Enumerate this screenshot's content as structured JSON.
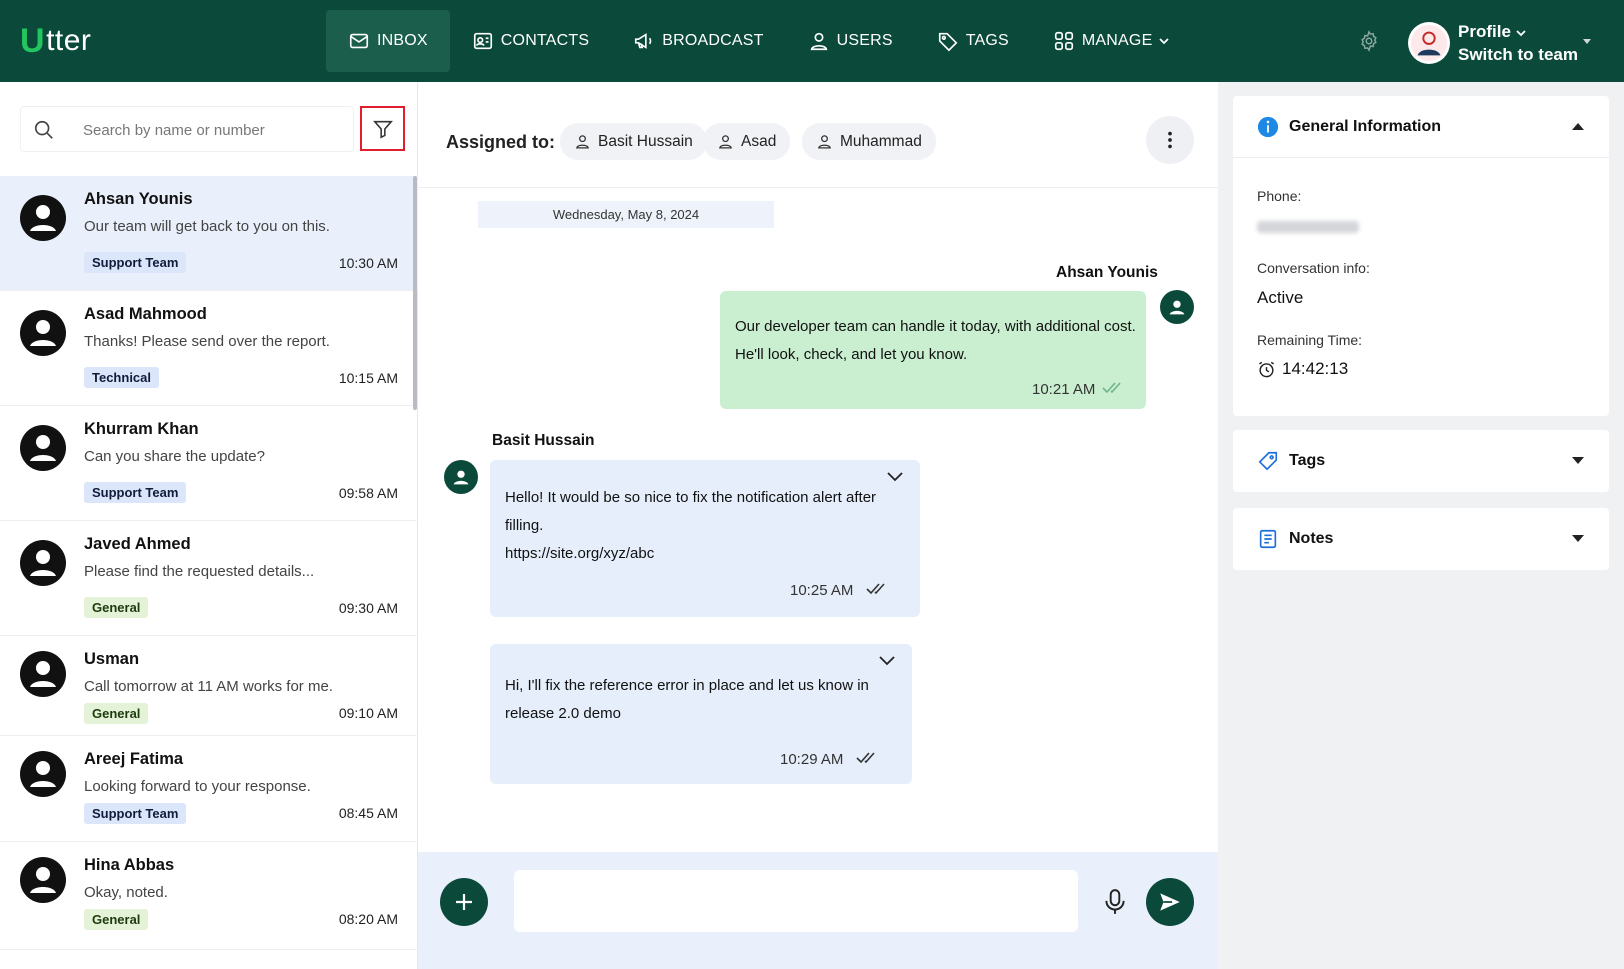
{
  "brand": {
    "logo_u": "U",
    "logo_rest": "tter"
  },
  "nav": {
    "items": [
      {
        "label": "INBOX",
        "icon": "mail-icon"
      },
      {
        "label": "CONTACTS",
        "icon": "contact-card-icon"
      },
      {
        "label": "BROADCAST",
        "icon": "megaphone-icon"
      },
      {
        "label": "USERS",
        "icon": "user-icon"
      },
      {
        "label": "TAGS",
        "icon": "tag-icon"
      },
      {
        "label": "MANAGE",
        "icon": "grid-icon"
      }
    ],
    "profile_label": "Profile",
    "switch_label": "Switch to team"
  },
  "search": {
    "placeholder": "Search by name or number"
  },
  "conversations": [
    {
      "name": "Ahsan Younis",
      "preview": "Our team will get back to you on this.",
      "badge": "Support Team",
      "badge_type": "support",
      "time": "10:30 AM"
    },
    {
      "name": "Asad Mahmood",
      "preview": "Thanks! Please send over the report.",
      "badge": "Technical",
      "badge_type": "technical",
      "time": "10:15 AM"
    },
    {
      "name": "Khurram Khan",
      "preview": "Can you share the update?",
      "badge": "Support Team",
      "badge_type": "support",
      "time": "09:58 AM"
    },
    {
      "name": "Javed Ahmed",
      "preview": "Please find the requested details...",
      "badge": "General",
      "badge_type": "general",
      "time": "09:30 AM"
    },
    {
      "name": "Usman",
      "preview": "Call tomorrow at 11 AM works for me.",
      "badge": "General",
      "badge_type": "general",
      "time": "09:10 AM"
    },
    {
      "name": "Areej Fatima",
      "preview": "Looking forward to your response.",
      "badge": "Support Team",
      "badge_type": "support",
      "time": "08:45 AM"
    },
    {
      "name": "Hina Abbas",
      "preview": "Okay, noted.",
      "badge": "General",
      "badge_type": "general",
      "time": "08:20 AM"
    }
  ],
  "chat": {
    "assigned_label": "Assigned to:",
    "assignees": [
      "Basit Hussain",
      "Asad",
      "Muhammad"
    ],
    "date": "Wednesday, May 8, 2024",
    "messages": [
      {
        "sender": "Ahsan Younis",
        "direction": "out",
        "lines": [
          "Our developer team can handle it today, with additional cost.",
          "He'll look, check, and let you know."
        ],
        "time": "10:21 AM"
      },
      {
        "sender": "Basit Hussain",
        "direction": "in",
        "lines": [
          "Hello! It would be so nice to fix the notification alert after",
          "filling.",
          "https://site.org/xyz/abc"
        ],
        "time": "10:25 AM"
      },
      {
        "sender": "",
        "direction": "in",
        "lines": [
          "Hi, I'll fix the reference error in place and let us know in",
          "release 2.0 demo"
        ],
        "time": "10:29 AM"
      }
    ],
    "composer_placeholder": ""
  },
  "details": {
    "general_title": "General Information",
    "phone_label": "Phone:",
    "conversation_label": "Conversation info:",
    "conversation_value": "Active",
    "remaining_label": "Remaining Time:",
    "remaining_value": "14:42:13",
    "tags_title": "Tags",
    "notes_title": "Notes"
  },
  "colors": {
    "primary": "#0b4a3a",
    "accent": "#22c55e",
    "outgoing_bubble": "#c9efd0",
    "incoming_bubble": "#e6eefb",
    "selected_row": "#e9f0fb",
    "filter_outline": "#e11d2e",
    "info_blue": "#1e88e5"
  }
}
